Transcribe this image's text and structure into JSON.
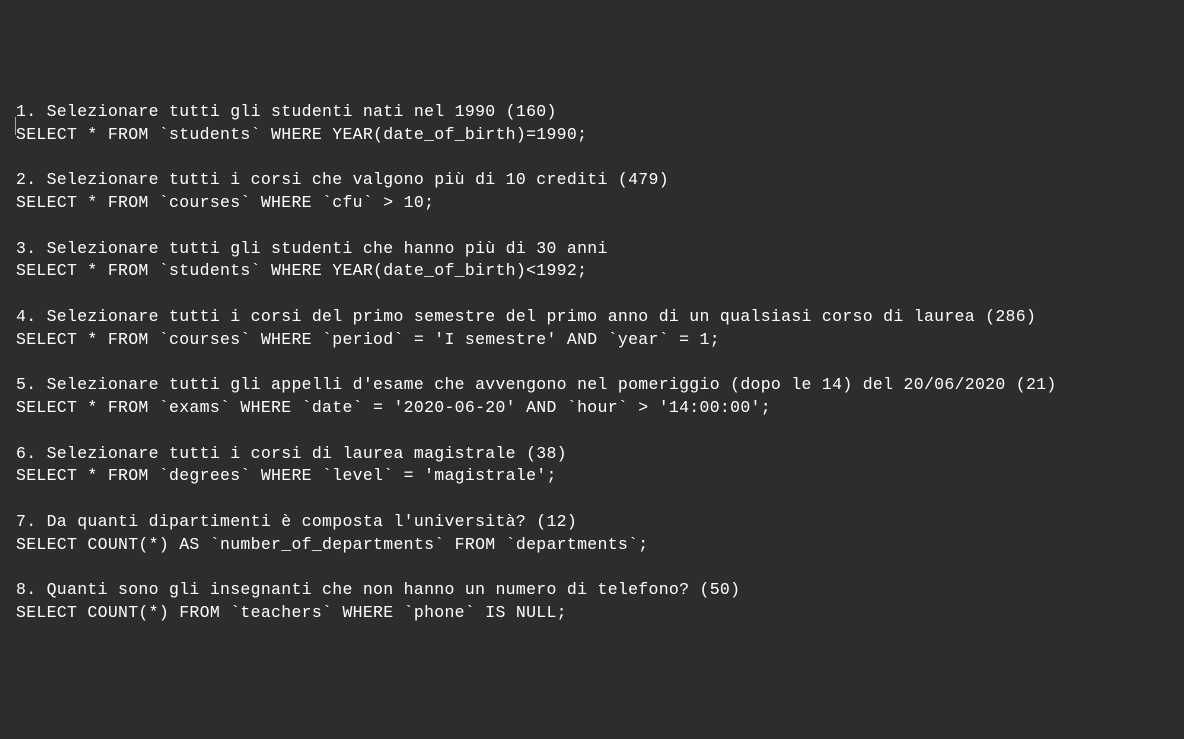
{
  "lines": [
    "1. Selezionare tutti gli studenti nati nel 1990 (160)",
    "SELECT * FROM `students` WHERE YEAR(date_of_birth)=1990; ",
    "",
    "2. Selezionare tutti i corsi che valgono più di 10 crediti (479)",
    "SELECT * FROM `courses` WHERE `cfu` > 10;",
    "",
    "3. Selezionare tutti gli studenti che hanno più di 30 anni",
    "SELECT * FROM `students` WHERE YEAR(date_of_birth)<1992;",
    "",
    "4. Selezionare tutti i corsi del primo semestre del primo anno di un qualsiasi corso di laurea (286)",
    "SELECT * FROM `courses` WHERE `period` = 'I semestre' AND `year` = 1;",
    "",
    "5. Selezionare tutti gli appelli d'esame che avvengono nel pomeriggio (dopo le 14) del 20/06/2020 (21)",
    "SELECT * FROM `exams` WHERE `date` = '2020-06-20' AND `hour` > '14:00:00';",
    "",
    "6. Selezionare tutti i corsi di laurea magistrale (38)",
    "SELECT * FROM `degrees` WHERE `level` = 'magistrale';",
    "",
    "7. Da quanti dipartimenti è composta l'università? (12)",
    "SELECT COUNT(*) AS `number_of_departments` FROM `departments`;",
    "",
    "8. Quanti sono gli insegnanti che non hanno un numero di telefono? (50)",
    "SELECT COUNT(*) FROM `teachers` WHERE `phone` IS NULL;"
  ]
}
